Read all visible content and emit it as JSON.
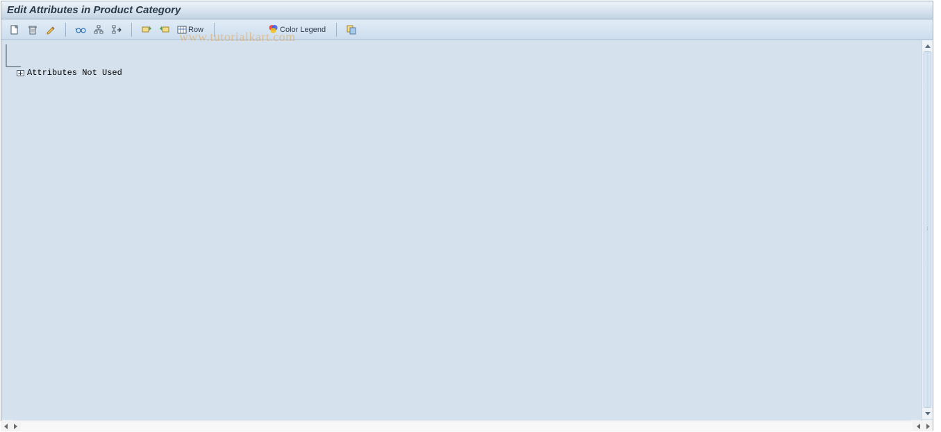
{
  "title": "Edit Attributes in Product Category",
  "toolbar": {
    "row_label": "Row",
    "color_legend_label": "Color Legend"
  },
  "tree": {
    "items": [
      {
        "label": "Attributes Not Used"
      }
    ]
  },
  "watermark": "www.tutorialkart.com"
}
